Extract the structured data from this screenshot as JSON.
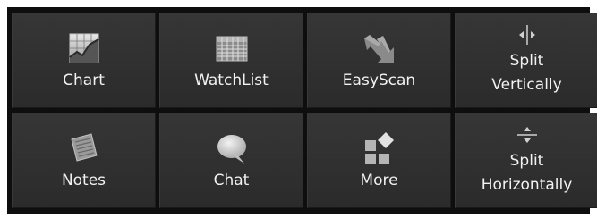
{
  "tiles_row1": [
    {
      "label": "Chart",
      "icon": "chart-icon"
    },
    {
      "label": "WatchList",
      "icon": "watchlist-grid-icon"
    },
    {
      "label": "EasyScan",
      "icon": "easyscan-arrow-icon"
    },
    {
      "label_line1": "Split",
      "label_line2": "Vertically",
      "icon": "split-vertical-icon"
    }
  ],
  "tiles_row2": [
    {
      "label": "Notes",
      "icon": "notes-icon"
    },
    {
      "label": "Chat",
      "icon": "chat-bubble-icon"
    },
    {
      "label": "More",
      "icon": "more-squares-icon"
    },
    {
      "label_line1": "Split",
      "label_line2": "Horizontally",
      "icon": "split-horizontal-icon"
    }
  ]
}
